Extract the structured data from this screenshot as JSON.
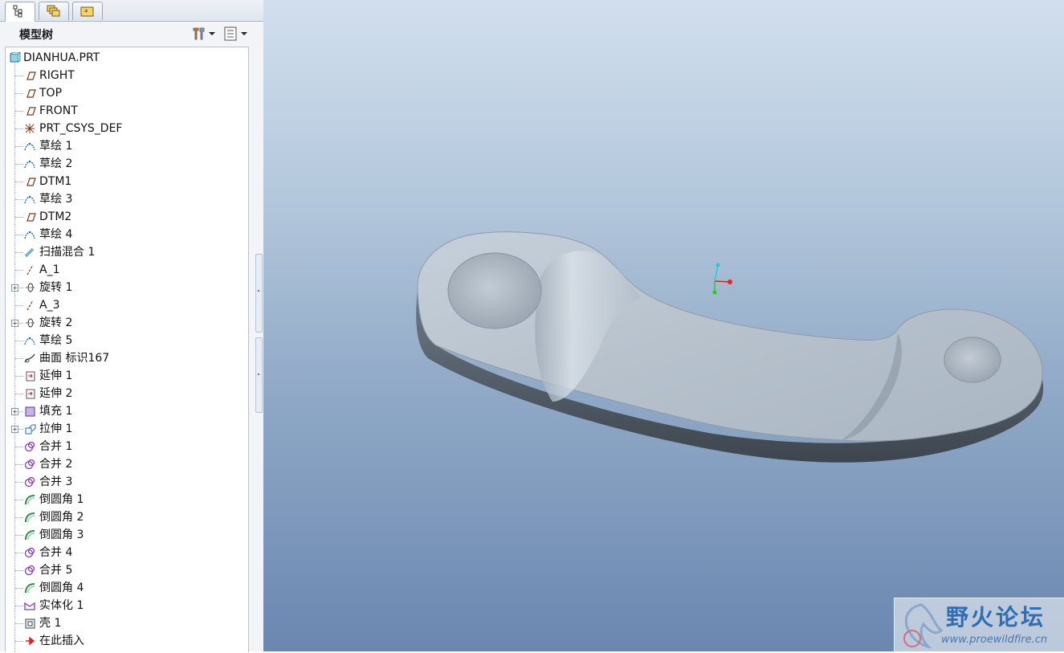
{
  "panel": {
    "title": "模型树",
    "tabs": [
      "model-tree-tab",
      "layers-tab",
      "favorites-tab"
    ]
  },
  "tree": {
    "root": "DIANHUA.PRT",
    "items": [
      {
        "label": "RIGHT",
        "icon": "datum-plane-icon"
      },
      {
        "label": "TOP",
        "icon": "datum-plane-icon"
      },
      {
        "label": "FRONT",
        "icon": "datum-plane-icon"
      },
      {
        "label": "PRT_CSYS_DEF",
        "icon": "csys-icon"
      },
      {
        "label": "草绘 1",
        "icon": "sketch-icon"
      },
      {
        "label": "草绘 2",
        "icon": "sketch-icon"
      },
      {
        "label": "DTM1",
        "icon": "datum-plane-icon"
      },
      {
        "label": "草绘 3",
        "icon": "sketch-icon"
      },
      {
        "label": "DTM2",
        "icon": "datum-plane-icon"
      },
      {
        "label": "草绘 4",
        "icon": "sketch-icon"
      },
      {
        "label": "扫描混合 1",
        "icon": "swept-blend-icon"
      },
      {
        "label": "A_1",
        "icon": "axis-icon"
      },
      {
        "label": "旋转 1",
        "icon": "revolve-icon",
        "expandable": true
      },
      {
        "label": "A_3",
        "icon": "axis-icon"
      },
      {
        "label": "旋转 2",
        "icon": "revolve-icon",
        "expandable": true
      },
      {
        "label": "草绘 5",
        "icon": "sketch-icon"
      },
      {
        "label": "曲面 标识167",
        "icon": "surface-icon"
      },
      {
        "label": "延伸 1",
        "icon": "extend-icon"
      },
      {
        "label": "延伸 2",
        "icon": "extend-icon"
      },
      {
        "label": "填充 1",
        "icon": "fill-icon",
        "expandable": true
      },
      {
        "label": "拉伸 1",
        "icon": "extrude-icon",
        "expandable": true
      },
      {
        "label": "合并 1",
        "icon": "merge-icon"
      },
      {
        "label": "合并 2",
        "icon": "merge-icon"
      },
      {
        "label": "合并 3",
        "icon": "merge-icon"
      },
      {
        "label": "倒圆角 1",
        "icon": "round-icon"
      },
      {
        "label": "倒圆角 2",
        "icon": "round-icon"
      },
      {
        "label": "倒圆角 3",
        "icon": "round-icon"
      },
      {
        "label": "合并 4",
        "icon": "merge-icon"
      },
      {
        "label": "合并 5",
        "icon": "merge-icon"
      },
      {
        "label": "倒圆角 4",
        "icon": "round-icon"
      },
      {
        "label": "实体化 1",
        "icon": "solidify-icon"
      },
      {
        "label": "壳 1",
        "icon": "shell-icon"
      },
      {
        "label": "在此插入",
        "icon": "insert-here-icon"
      }
    ]
  },
  "watermark": {
    "title": "野火论坛",
    "url": "www.proewildfire.cn"
  },
  "colors": {
    "accent": "#2f6db4",
    "viewport_top": "#d1dfee",
    "viewport_bottom": "#6a87b0"
  }
}
